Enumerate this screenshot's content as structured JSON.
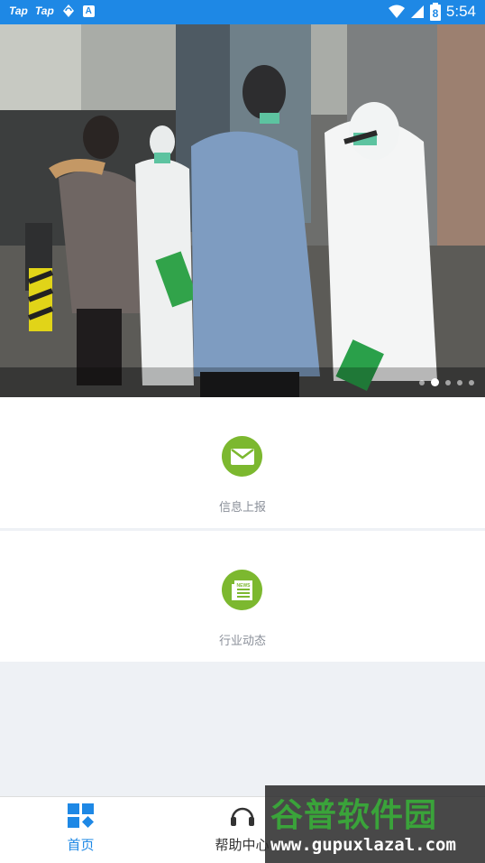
{
  "status_bar": {
    "badges": [
      "Tap",
      "Tap"
    ],
    "a_badge": "A",
    "battery_digit": "8",
    "time": "5:54"
  },
  "banner": {
    "image": "street-checkpoint-photo",
    "page_count": 5,
    "active_page": 2
  },
  "menu": [
    {
      "label": "信息上报",
      "icon": "envelope-icon"
    },
    {
      "label": "行业动态",
      "icon": "news-icon",
      "icon_text": "NEWS"
    }
  ],
  "nav": [
    {
      "label": "首页",
      "icon": "home-grid-icon",
      "active": true
    },
    {
      "label": "帮助中心",
      "icon": "headset-icon",
      "active": false
    }
  ],
  "colors": {
    "status_bar": "#1e88e5",
    "accent_green": "#7cb82f",
    "nav_active": "#1e88e5",
    "nav_inactive": "#333333"
  },
  "watermark": {
    "title": "谷普软件园",
    "url": "www.gupuxlazal.com"
  }
}
